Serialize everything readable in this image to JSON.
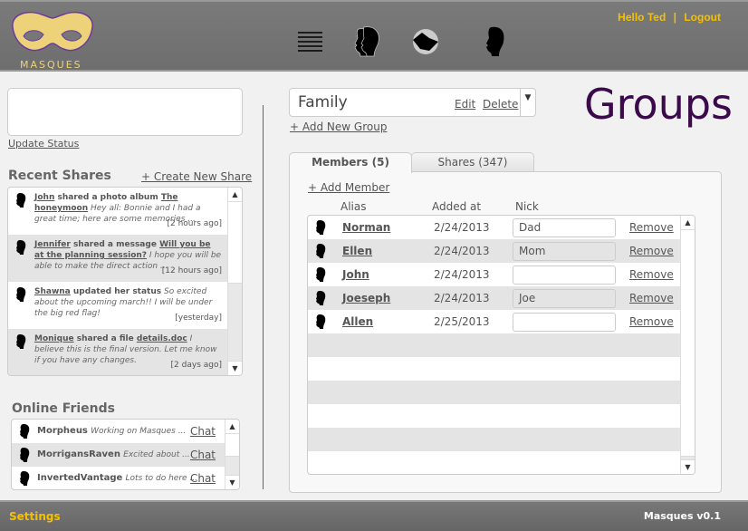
{
  "header": {
    "logo_text": "MASQUES",
    "greeting": "Hello Ted",
    "separator": "|",
    "logout": "Logout",
    "nav_icons": [
      "list-icon",
      "groups-icon",
      "handshake-icon",
      "profile-icon"
    ]
  },
  "status": {
    "value": "",
    "update_label": "Update Status"
  },
  "recent_shares": {
    "title": "Recent Shares",
    "create_label": "+ Create New Share",
    "items": [
      {
        "user": "John",
        "action": " shared a photo album ",
        "object": "The honeymoon",
        "text": " Hey all: Bonnie and I had a great time; here are some memories ...",
        "time": "[2 hours ago]"
      },
      {
        "user": "Jennifer",
        "action": " shared a message ",
        "object": "Will you be at the planning session?",
        "text": " I hope you will be able to make the direct action ...",
        "time": "[12 hours ago]"
      },
      {
        "user": "Shawna",
        "action": " updated her status",
        "object": "",
        "text": " So excited about the upcoming march!! I will be under the big red flag!",
        "time": "[yesterday]"
      },
      {
        "user": "Monique",
        "action": " shared a file ",
        "object": "details.doc",
        "text": " I believe this is the final version. Let me know if you have any changes.",
        "time": "[2 days ago]"
      }
    ]
  },
  "online_friends": {
    "title": "Online Friends",
    "chat_label": "Chat",
    "items": [
      {
        "name": "Morpheus",
        "status": "Working on Masques  ..."
      },
      {
        "name": "MorrigansRaven",
        "status": "Excited about ..."
      },
      {
        "name": "InvertedVantage",
        "status": "Lots to do here ..."
      }
    ]
  },
  "group": {
    "selected": "Family",
    "edit": "Edit",
    "delete": "Delete",
    "add_group": "+ Add New Group"
  },
  "page_title": "Groups",
  "tabs": [
    {
      "label": "Members (5)",
      "active": true
    },
    {
      "label": "Shares (347)",
      "active": false
    }
  ],
  "members": {
    "add_label": "+ Add Member",
    "columns": [
      "Alias",
      "Added at",
      "Nick"
    ],
    "remove_label": "Remove",
    "rows": [
      {
        "alias": "Norman",
        "added": "2/24/2013",
        "nick": "Dad"
      },
      {
        "alias": "Ellen",
        "added": "2/24/2013",
        "nick": "Mom"
      },
      {
        "alias": "John",
        "added": "2/24/2013",
        "nick": ""
      },
      {
        "alias": "Joeseph",
        "added": "2/24/2013",
        "nick": "Joe"
      },
      {
        "alias": "Allen",
        "added": "2/25/2013",
        "nick": ""
      }
    ]
  },
  "footer": {
    "settings": "Settings",
    "version": "Masques v0.1"
  },
  "colors": {
    "accent": "#f5c000",
    "title": "#3a0a4a",
    "header": "#727272",
    "mask": "#eed27a"
  }
}
